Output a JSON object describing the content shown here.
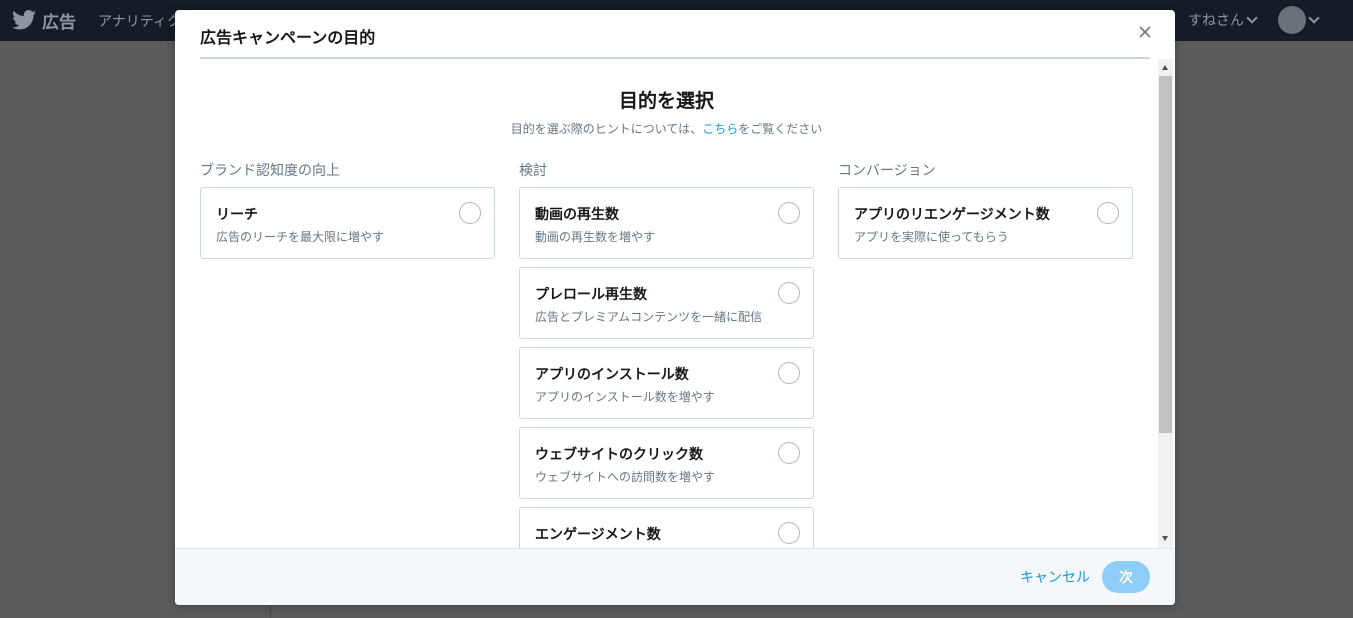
{
  "topbar": {
    "brand_label": "広告",
    "nav_analytics": "アナリティクス",
    "user_name": "すねさん"
  },
  "modal": {
    "title": "広告キャンペーンの目的",
    "section_title": "目的を選択",
    "hint_prefix": "目的を選ぶ際のヒントについては、",
    "hint_link": "こちら",
    "hint_suffix": "をご覧ください",
    "columns": [
      {
        "label": "ブランド認知度の向上",
        "cards": [
          {
            "title": "リーチ",
            "desc": "広告のリーチを最大限に増やす"
          }
        ]
      },
      {
        "label": "検討",
        "cards": [
          {
            "title": "動画の再生数",
            "desc": "動画の再生数を増やす"
          },
          {
            "title": "プレロール再生数",
            "desc": "広告とプレミアムコンテンツを一緒に配信"
          },
          {
            "title": "アプリのインストール数",
            "desc": "アプリのインストール数を増やす"
          },
          {
            "title": "ウェブサイトのクリック数",
            "desc": "ウェブサイトへの訪問数を増やす"
          },
          {
            "title": "エンゲージメント数",
            "desc": ""
          }
        ]
      },
      {
        "label": "コンバージョン",
        "cards": [
          {
            "title": "アプリのリエンゲージメント数",
            "desc": "アプリを実際に使ってもらう"
          }
        ]
      }
    ],
    "footer": {
      "cancel_label": "キャンセル",
      "next_label": "次"
    }
  },
  "colors": {
    "accent": "#1b95e0",
    "next_disabled": "#8ecdf7",
    "topbar": "#141d26"
  }
}
